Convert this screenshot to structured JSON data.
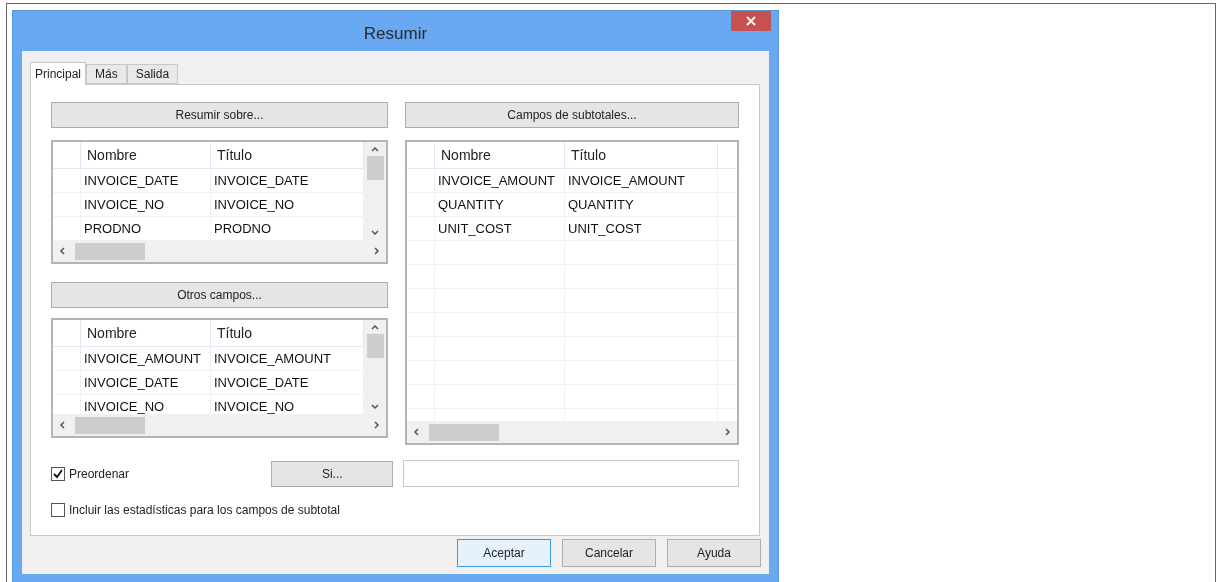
{
  "window": {
    "title": "Resumir"
  },
  "tabs": [
    {
      "label": "Principal",
      "selected": true
    },
    {
      "label": "Más",
      "selected": false
    },
    {
      "label": "Salida",
      "selected": false
    }
  ],
  "summarize_on": {
    "button": "Resumir sobre...",
    "table": {
      "columns": [
        "Nombre",
        "Título"
      ],
      "rows": [
        [
          "INVOICE_DATE",
          "INVOICE_DATE"
        ],
        [
          "INVOICE_NO",
          "INVOICE_NO"
        ],
        [
          "PRODNO",
          "PRODNO"
        ]
      ]
    }
  },
  "other_fields": {
    "button": "Otros campos...",
    "table": {
      "columns": [
        "Nombre",
        "Título"
      ],
      "rows": [
        [
          "INVOICE_AMOUNT",
          "INVOICE_AMOUNT"
        ],
        [
          "INVOICE_DATE",
          "INVOICE_DATE"
        ],
        [
          "INVOICE_NO",
          "INVOICE_NO"
        ]
      ]
    }
  },
  "subtotal_fields": {
    "button": "Campos de subtotales...",
    "table": {
      "columns": [
        "Nombre",
        "Título"
      ],
      "rows": [
        [
          "INVOICE_AMOUNT",
          "INVOICE_AMOUNT"
        ],
        [
          "QUANTITY",
          "QUANTITY"
        ],
        [
          "UNIT_COST",
          "UNIT_COST"
        ]
      ]
    }
  },
  "presort": {
    "label": "Preordenar",
    "checked": true
  },
  "if_button": "Si...",
  "include_stats": {
    "label": "Incluir las estadísticas para los campos de subtotal",
    "checked": false
  },
  "buttons": [
    {
      "label": "Aceptar",
      "default": true
    },
    {
      "label": "Cancelar",
      "default": false
    },
    {
      "label": "Ayuda",
      "default": false
    }
  ]
}
